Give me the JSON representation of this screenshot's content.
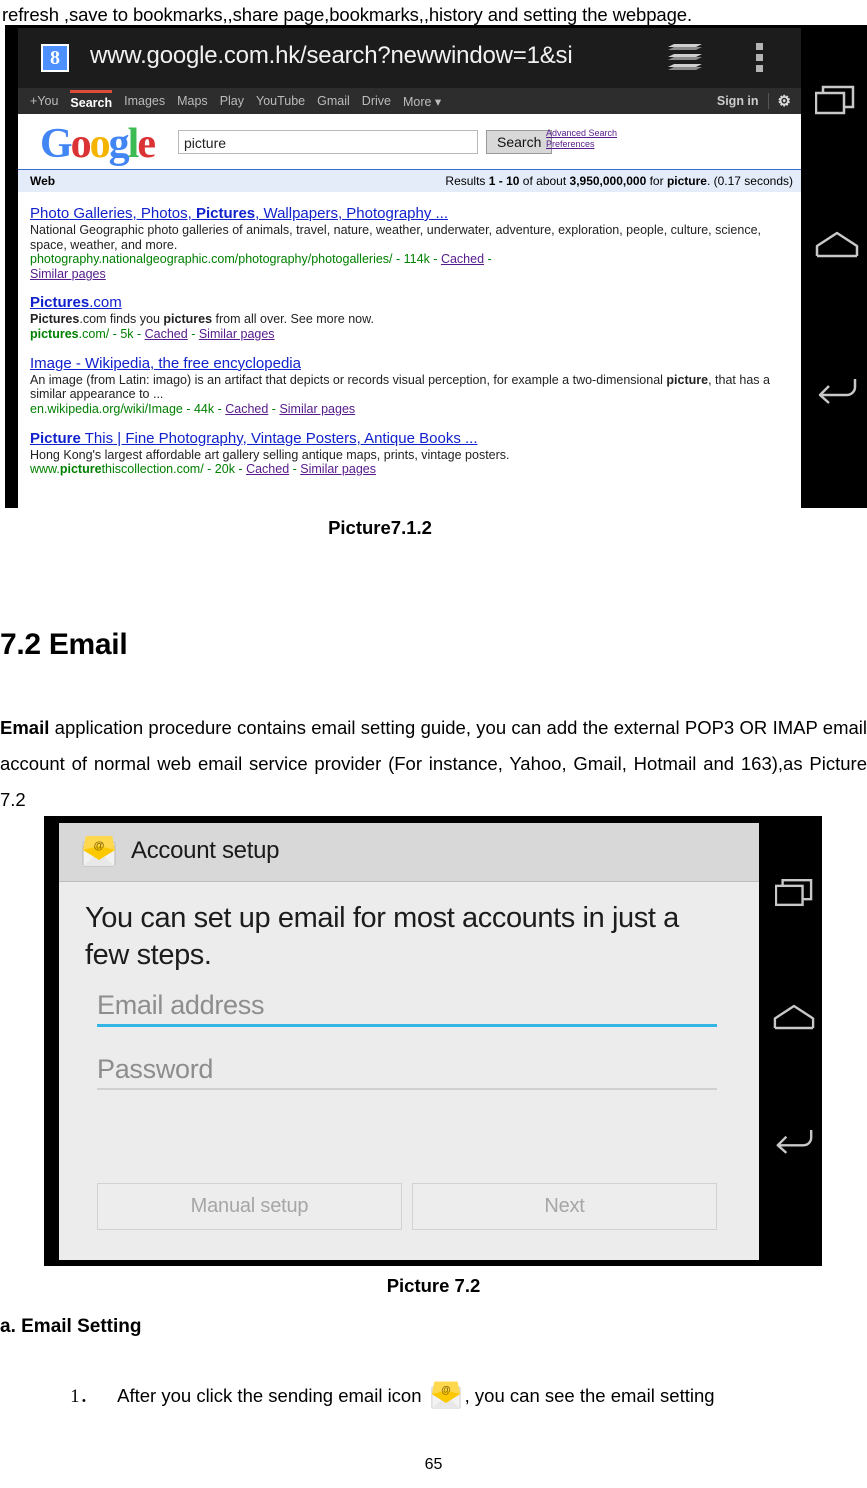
{
  "document": {
    "intro_line": "refresh ,save to bookmarks,,share page,bookmarks,,history and setting the webpage.",
    "caption_1": "Picture7.1.2",
    "section_heading": "7.2 Email",
    "paragraph_lead": "Email",
    "paragraph_rest": " application procedure contains email setting guide, you can add the external POP3 OR IMAP email account of normal web email service provider (For instance, Yahoo, Gmail, Hotmail and 163),as Picture 7.2",
    "caption_2": "Picture 7.2",
    "subsection_heading": "a. Email Setting",
    "list_item_number": "1．",
    "list_item_before_icon": "After you click the sending email icon",
    "list_item_after_icon": ", you can see the email setting",
    "page_number": "65"
  },
  "browser_screenshot": {
    "url": "www.google.com.hk/search?newwindow=1&si",
    "favicon_letter": "8",
    "tabs_icon": "tab-stack-icon",
    "menu_icon": "overflow-menu-icon",
    "google_nav": {
      "items": [
        "+You",
        "Search",
        "Images",
        "Maps",
        "Play",
        "YouTube",
        "Gmail",
        "Drive",
        "More ▾"
      ],
      "selected": "Search",
      "sign_in": "Sign in",
      "settings_icon": "gear-icon"
    },
    "logo": {
      "g1": "G",
      "o1": "o",
      "o2": "o",
      "g2": "g",
      "l": "l",
      "e": "e"
    },
    "search_query": "picture",
    "search_button": "Search",
    "advanced_search": "Advanced Search",
    "preferences": "Preferences",
    "results_tab": "Web",
    "results_count_pre": "Results ",
    "results_count": "1 - 10",
    "results_count_mid": " of about ",
    "results_total": "3,950,000,000",
    "results_count_for": " for ",
    "results_query": "picture",
    "results_time": ". (0.17 seconds)",
    "results": [
      {
        "title_pre": "Photo Galleries, Photos, ",
        "title_bold": "Pictures",
        "title_post": ", Wallpapers, Photography ...",
        "desc": "National Geographic photo galleries of animals, travel, nature, weather, underwater, adventure, exploration, people, culture, science, space, weather, and more.",
        "url": "photography.nationalgeographic.com/photography/photogalleries/",
        "size": "114k",
        "cached": "Cached",
        "similar": "Similar pages"
      },
      {
        "title_bold": "Pictures",
        "title_post": ".com",
        "title_pre": "",
        "desc_pre_bold": "Pictures",
        "desc_mid": ".com finds you ",
        "desc_bold2": "pictures",
        "desc_post": " from all over. See more now.",
        "url_bold": "pictures",
        "url_rest": ".com/",
        "size": "5k",
        "cached": "Cached",
        "similar": "Similar pages"
      },
      {
        "title_pre": "Image - Wikipedia, the free encyclopedia",
        "desc_pre": "An image (from Latin: imago) is an artifact that depicts or records visual perception, for example a two-dimensional ",
        "desc_bold": "picture",
        "desc_post": ", that has a similar appearance to ...",
        "url": "en.wikipedia.org/wiki/Image",
        "size": "44k",
        "cached": "Cached",
        "similar": "Similar pages"
      },
      {
        "title_bold": "Picture",
        "title_post": " This | Fine Photography, Vintage Posters, Antique Books ...",
        "desc": "Hong Kong's largest affordable art gallery selling antique maps, prints, vintage posters.",
        "url_pre": "www.",
        "url_bold": "picture",
        "url_rest": "thiscollection.com/",
        "size": "20k",
        "cached": "Cached",
        "similar": "Similar pages"
      }
    ],
    "nav_bar": {
      "recents_icon": "recents-icon",
      "home_icon": "home-icon",
      "back_icon": "back-icon"
    }
  },
  "email_screenshot": {
    "app_icon": "email-envelope-icon",
    "title": "Account setup",
    "intro": "You can set up email for most accounts in just a few steps.",
    "email_placeholder": "Email address",
    "password_placeholder": "Password",
    "manual_setup_label": "Manual setup",
    "next_label": "Next",
    "accent_color": "#33b5e5",
    "nav_bar": {
      "recents_icon": "recents-icon",
      "home_icon": "home-icon",
      "back_icon": "back-icon"
    }
  }
}
